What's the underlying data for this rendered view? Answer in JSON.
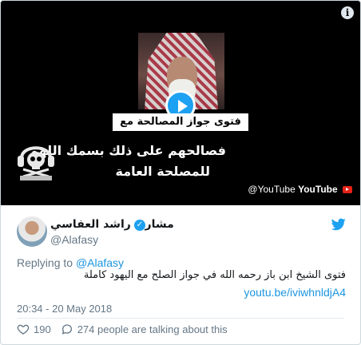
{
  "media": {
    "info_icon": "i",
    "banner_text": "فتوى جواز المصالحة مع اليهود",
    "overlay_line1": "فصالحهم على ذلك بسمك اللهم",
    "overlay_line2": "للمصلحة العامة",
    "watermark_handle": "@YouTube",
    "watermark_brand": "YouTube",
    "play_icon": "play-icon",
    "logo_icon": "skull-headphones-logo"
  },
  "author": {
    "display_name": "مشاري راشد العفاسي",
    "handle": "@Alafasy",
    "verified_mark": "✓"
  },
  "tweet": {
    "reply_prefix": "Replying to",
    "reply_handle": "@Alafasy",
    "text": "فتوى الشيخ ابن باز رحمه الله في جواز الصلح مع اليهود كاملة",
    "link": "youtu.be/iviwhnldjA4",
    "timestamp": "20:34 - 20 May 2018"
  },
  "actions": {
    "likes": "190",
    "conversation": "274 people are talking about this"
  },
  "colors": {
    "accent": "#1da1f2",
    "link": "#1b95e0",
    "muted": "#657786",
    "youtube_red": "#e62117"
  }
}
